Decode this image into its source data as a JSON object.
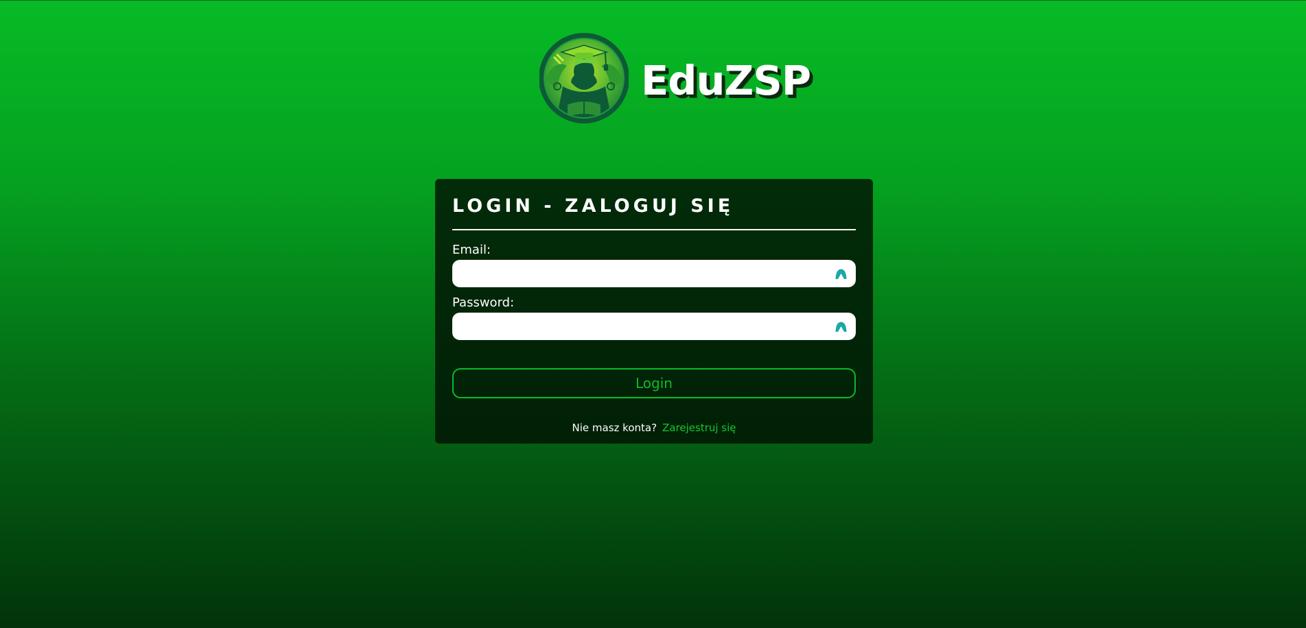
{
  "brand": {
    "name": "EduZSP",
    "logo_icon": "graduate-student-reading-book-logo"
  },
  "login_form": {
    "title": "LOGIN - ZALOGUJ SIĘ",
    "email_label": "Email:",
    "email_value": "",
    "password_label": "Password:",
    "password_value": "",
    "field_icon": "password-manager-autofill-icon",
    "submit_label": "Login"
  },
  "register": {
    "prompt": "Nie masz konta?",
    "link_label": "Zarejestruj się"
  },
  "colors": {
    "background_top": "#07bb25",
    "background_bottom": "#02330a",
    "card_background": "#022c09",
    "accent": "#0dbb27",
    "field_icon": "#1aa8a8"
  }
}
